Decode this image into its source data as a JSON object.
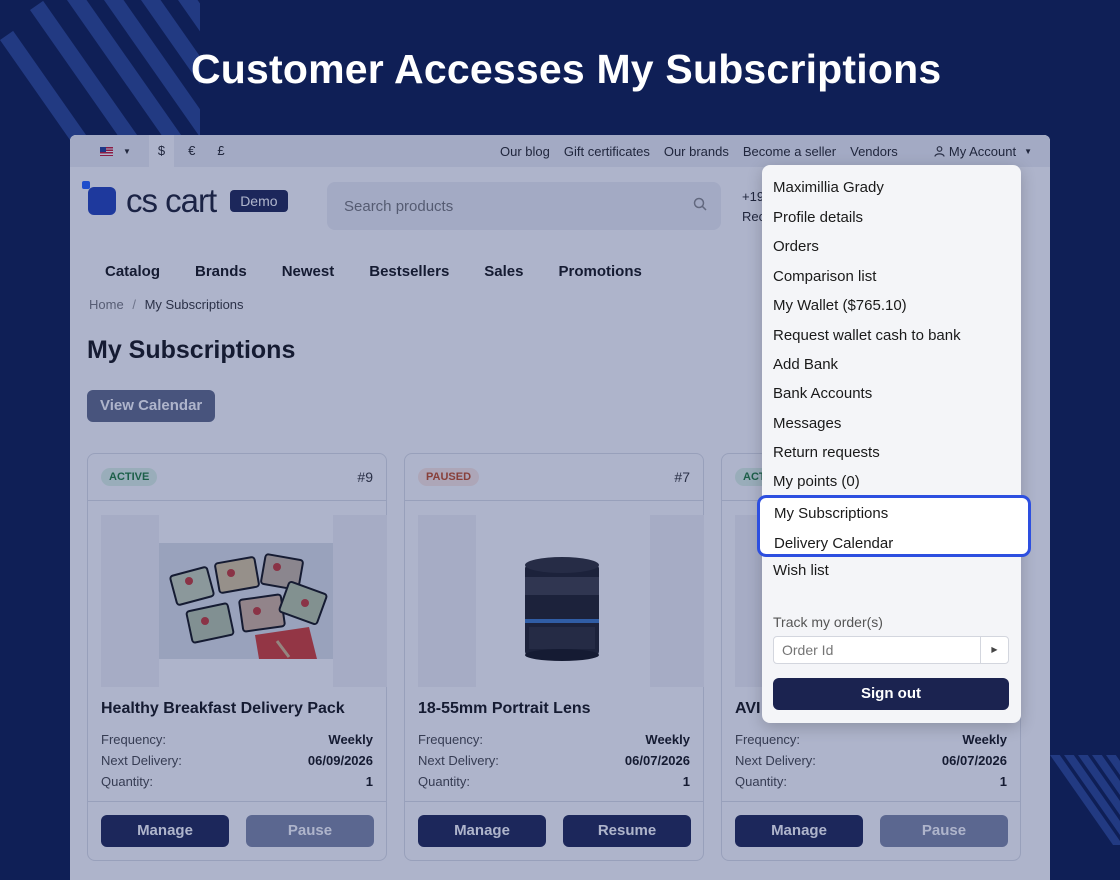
{
  "headline": "Customer Accesses My Subscriptions",
  "topbar": {
    "currencies": [
      "$",
      "€",
      "£"
    ],
    "links": [
      "Our blog",
      "Gift certificates",
      "Our brands",
      "Become a seller",
      "Vendors"
    ],
    "account_label": "My Account"
  },
  "header": {
    "logo_text": "cs cart",
    "demo_label": "Demo",
    "search_placeholder": "Search products",
    "phone_line1": "+19",
    "phone_line2": "Rec"
  },
  "nav": [
    "Catalog",
    "Brands",
    "Newest",
    "Bestsellers",
    "Sales",
    "Promotions"
  ],
  "breadcrumb": {
    "home": "Home",
    "sep": "/",
    "current": "My Subscriptions"
  },
  "page_title": "My Subscriptions",
  "view_calendar_label": "View Calendar",
  "labels": {
    "frequency": "Frequency:",
    "next_delivery": "Next Delivery:",
    "quantity": "Quantity:"
  },
  "cards": [
    {
      "status": "ACTIVE",
      "number": "#9",
      "title": "Healthy Breakfast Delivery Pack",
      "frequency": "Weekly",
      "next_delivery": "06/09/2026",
      "quantity": "1",
      "btn1": "Manage",
      "btn2": "Pause"
    },
    {
      "status": "PAUSED",
      "number": "#7",
      "title": "18-55mm Portrait Lens",
      "frequency": "Weekly",
      "next_delivery": "06/07/2026",
      "quantity": "1",
      "btn1": "Manage",
      "btn2": "Resume"
    },
    {
      "status": "ACTIVE",
      "number": "",
      "title": "AVI",
      "frequency": "Weekly",
      "next_delivery": "06/07/2026",
      "quantity": "1",
      "btn1": "Manage",
      "btn2": "Pause"
    }
  ],
  "dropdown": {
    "items": [
      "Maximillia Grady",
      "Profile details",
      "Orders",
      "Comparison list",
      "My Wallet ($765.10)",
      "Request wallet cash to bank",
      "Add Bank",
      "Bank Accounts",
      "Messages",
      "Return requests",
      "My points (0)"
    ],
    "highlighted": [
      "My Subscriptions",
      "Delivery Calendar"
    ],
    "wish_list": "Wish list",
    "track_label": "Track my order(s)",
    "order_placeholder": "Order Id",
    "sign_out": "Sign out"
  },
  "colors": {
    "background": "#0f1f56",
    "highlight_border": "#2d4fe0",
    "primary_button": "#1b2350"
  }
}
